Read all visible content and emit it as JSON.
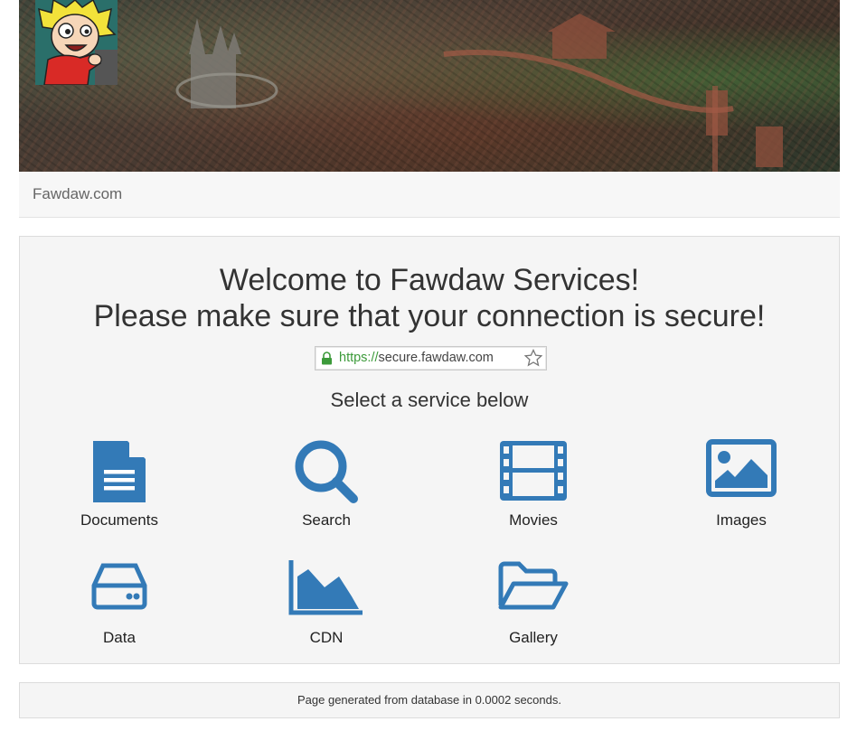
{
  "site": {
    "brand": "Fawdaw.com"
  },
  "welcome": {
    "line1": "Welcome to Fawdaw Services!",
    "line2": "Please make sure that your connection is secure!"
  },
  "address_bar": {
    "scheme": "https://",
    "host": "secure.fawdaw.com"
  },
  "select_prompt": "Select a service below",
  "services": [
    {
      "label": "Documents",
      "icon": "document-icon"
    },
    {
      "label": "Search",
      "icon": "search-icon"
    },
    {
      "label": "Movies",
      "icon": "film-icon"
    },
    {
      "label": "Images",
      "icon": "picture-icon"
    },
    {
      "label": "Data",
      "icon": "hard-drive-icon"
    },
    {
      "label": "CDN",
      "icon": "area-chart-icon"
    },
    {
      "label": "Gallery",
      "icon": "folder-open-icon"
    }
  ],
  "footer": {
    "text": "Page generated from database in 0.0002 seconds."
  },
  "colors": {
    "icon": "#337ab7",
    "panel": "#f5f5f5",
    "secure_green": "#3c9a3a"
  }
}
